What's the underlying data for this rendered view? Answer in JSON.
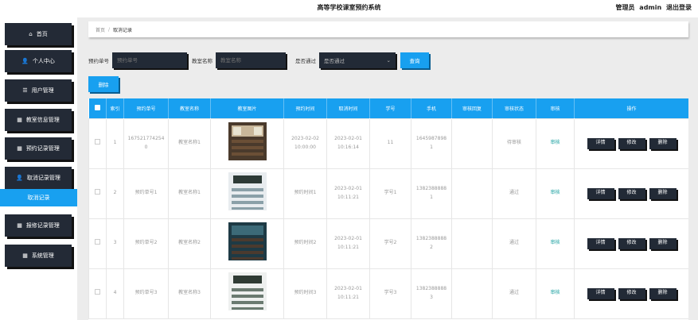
{
  "header": {
    "title": "高等学校课室预约系统",
    "user_label": "管理员",
    "username": "admin",
    "logout": "退出登录"
  },
  "sidebar": {
    "items": [
      {
        "icon": "home-icon",
        "glyph": "⌂",
        "label": "首页"
      },
      {
        "icon": "user-icon",
        "glyph": "👤",
        "label": "个人中心"
      },
      {
        "icon": "sliders-icon",
        "glyph": "☰",
        "label": "用户管理"
      },
      {
        "icon": "grid-icon",
        "glyph": "▦",
        "label": "教室信息管理"
      },
      {
        "icon": "grid-icon",
        "glyph": "▦",
        "label": "预约记录管理"
      },
      {
        "icon": "user-icon",
        "glyph": "👤",
        "label": "取消记录管理"
      },
      {
        "icon": "grid-icon",
        "glyph": "▦",
        "label": "报修记录管理"
      },
      {
        "icon": "grid-icon",
        "glyph": "▦",
        "label": "系统管理"
      }
    ],
    "active_sub": "取消记录"
  },
  "breadcrumb": {
    "home": "首页",
    "separator": "/",
    "current": "取消记录"
  },
  "search": {
    "booking_no_label": "预约单号",
    "booking_no_placeholder": "预约单号",
    "room_name_label": "教室名称",
    "room_name_placeholder": "教室名称",
    "passed_label": "是否通过",
    "passed_selected": "是否通过",
    "query_button": "查询"
  },
  "toolbar": {
    "delete_button": "删除"
  },
  "table": {
    "headers": [
      "",
      "索引",
      "预约单号",
      "教室名称",
      "教室图片",
      "预约时间",
      "取消时间",
      "学号",
      "手机",
      "审核回复",
      "审核状态",
      "审核",
      "操作"
    ],
    "rows": [
      {
        "index": "1",
        "booking_no": "1675217742540",
        "room": "教室名称1",
        "book_time": "2023-02-02 10:00:00",
        "cancel_time": "2023-02-01 10:16:14",
        "student_no": "11",
        "phone": "16459878981",
        "reply": "",
        "status": "待审核",
        "audit": "审核"
      },
      {
        "index": "2",
        "booking_no": "预约单号1",
        "room": "教室名称1",
        "book_time": "预约时间1",
        "cancel_time": "2023-02-01 10:11:21",
        "student_no": "学号1",
        "phone": "13823888881",
        "reply": "",
        "status": "通过",
        "audit": "审核"
      },
      {
        "index": "3",
        "booking_no": "预约单号2",
        "room": "教室名称2",
        "book_time": "预约时间2",
        "cancel_time": "2023-02-01 10:11:21",
        "student_no": "学号2",
        "phone": "13823888882",
        "reply": "",
        "status": "通过",
        "audit": "审核"
      },
      {
        "index": "4",
        "booking_no": "预约单号3",
        "room": "教室名称3",
        "book_time": "预约时间3",
        "cancel_time": "2023-02-01 10:11:21",
        "student_no": "学号3",
        "phone": "13823888883",
        "reply": "",
        "status": "通过",
        "audit": "审核"
      }
    ],
    "op_labels": {
      "detail": "详情",
      "edit": "修改",
      "delete": "删除"
    }
  },
  "colors": {
    "accent": "#18a0f0",
    "dark_button": "#222a36",
    "audit_link": "#1aa0a0"
  }
}
